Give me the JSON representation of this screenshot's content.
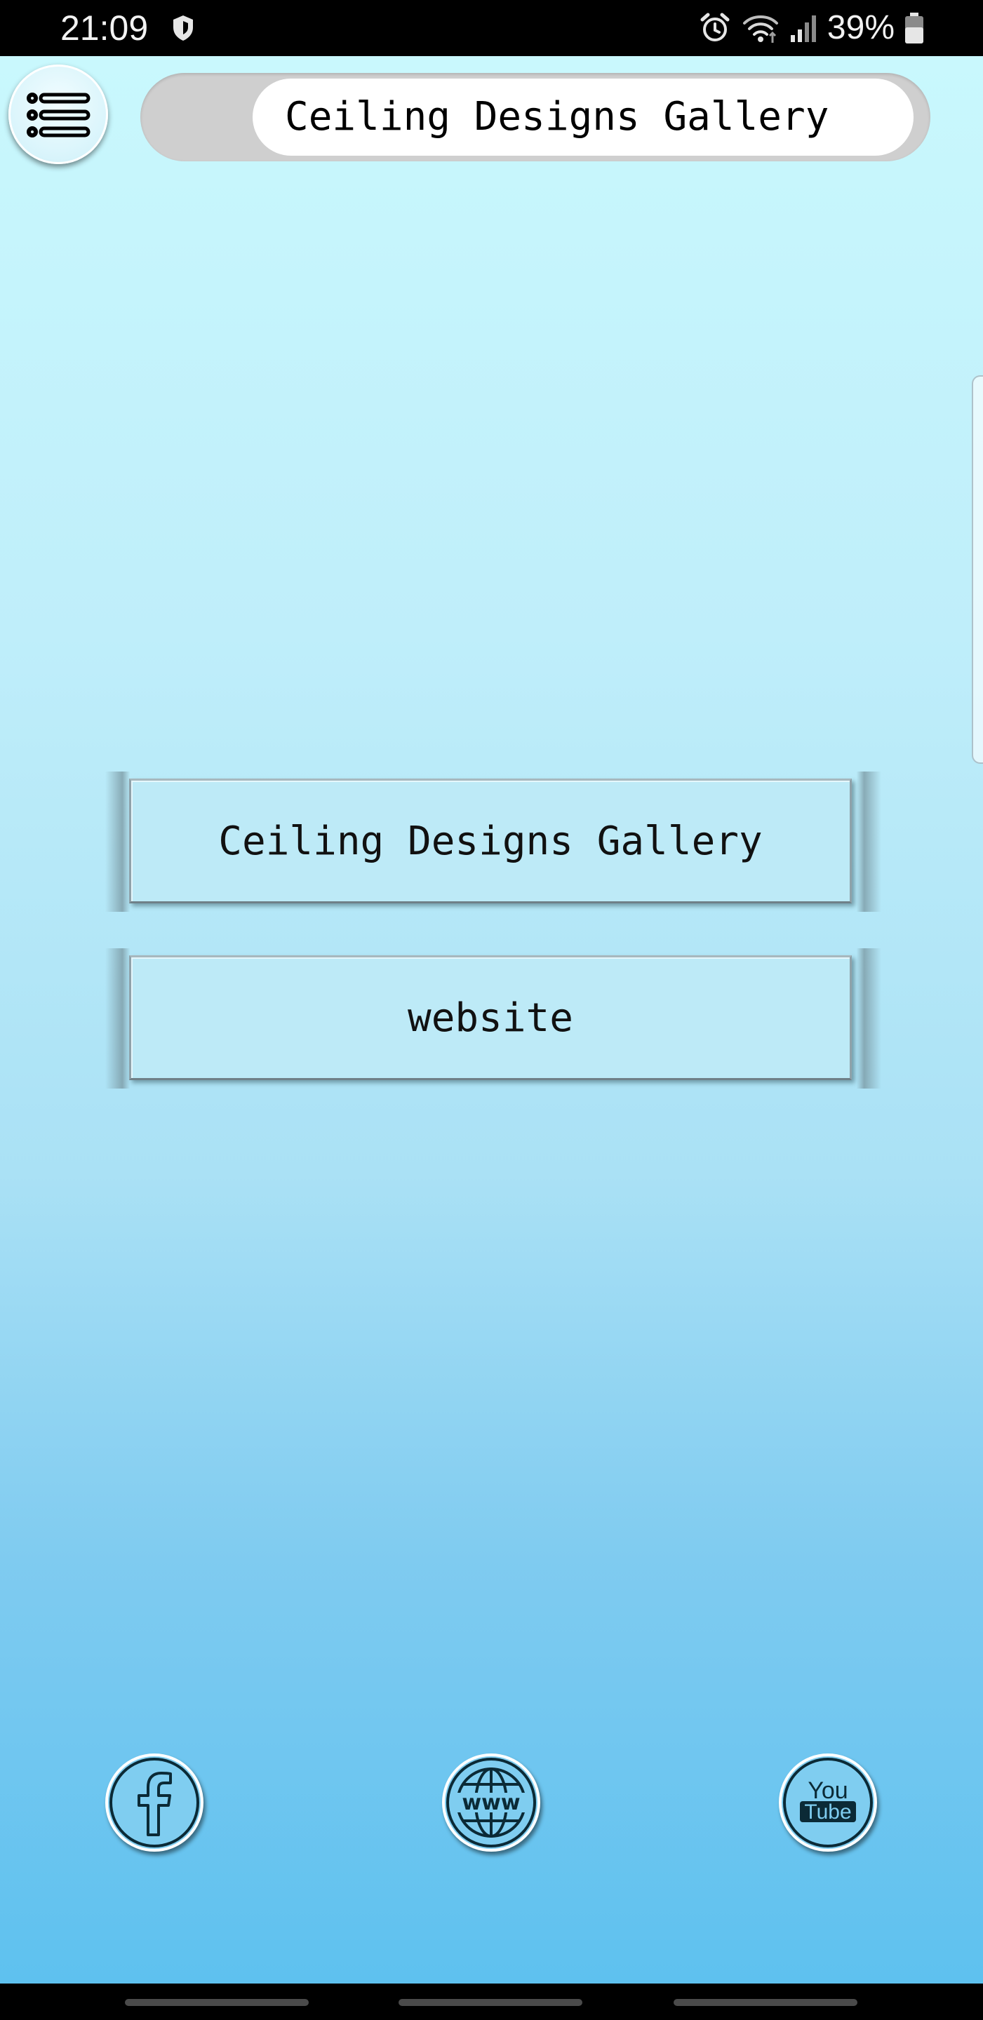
{
  "status_bar": {
    "time": "21:09",
    "battery_percent": "39%",
    "icons": [
      "shield-icon",
      "alarm-icon",
      "wifi-icon",
      "signal-icon",
      "battery-icon"
    ]
  },
  "header": {
    "menu_icon": "list-menu-icon",
    "title": "Ceiling Designs Gallery"
  },
  "main": {
    "buttons": [
      {
        "label": "Ceiling Designs Gallery"
      },
      {
        "label": "website"
      }
    ]
  },
  "social": {
    "items": [
      {
        "icon": "facebook-icon"
      },
      {
        "icon": "www-globe-icon",
        "text": "www"
      },
      {
        "icon": "youtube-icon",
        "text_top": "You",
        "text_bottom": "Tube"
      }
    ]
  },
  "colors": {
    "gradient_top": "#c9f8fd",
    "gradient_bottom": "#5ec1ef",
    "button_face": "#bdeaf7",
    "title_pill": "#cfcfcf"
  }
}
